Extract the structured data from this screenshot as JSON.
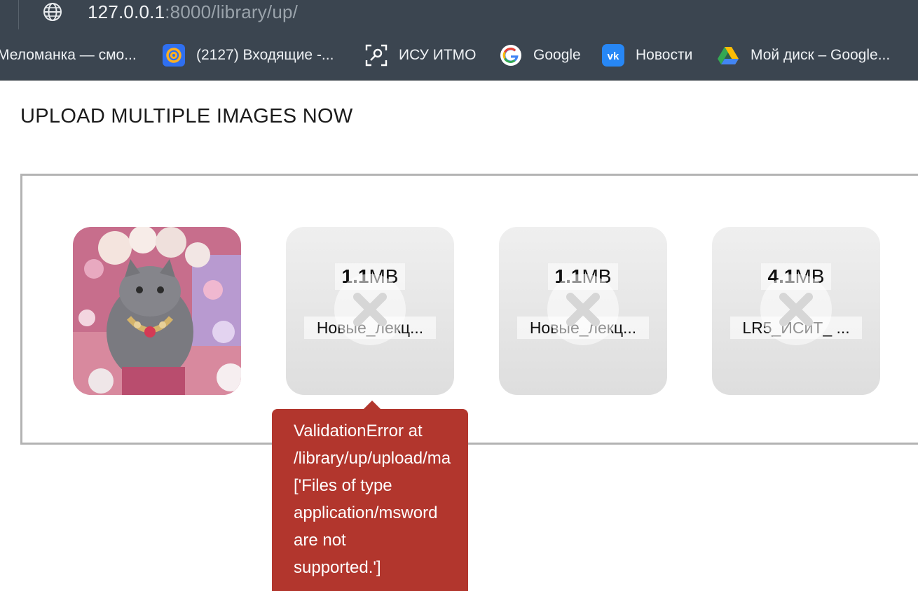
{
  "browser": {
    "url_host": "127.0.0.1",
    "url_rest": ":8000/library/up/",
    "bookmarks": [
      {
        "label": "Меломанка — смо...",
        "icon": "none"
      },
      {
        "label": "(2127) Входящие -...",
        "icon": "mail-icon"
      },
      {
        "label": "ИСУ ИТМО",
        "icon": "itmo-icon"
      },
      {
        "label": "Google",
        "icon": "google-icon"
      },
      {
        "label": "Новости",
        "icon": "vk-icon"
      },
      {
        "label": "Мой диск – Google...",
        "icon": "google-drive-icon"
      }
    ]
  },
  "page": {
    "title": "UPLOAD MULTIPLE IMAGES NOW"
  },
  "files": [
    {
      "size_num": "1.1",
      "size_unit": " MB",
      "name": "Новые_лекц...",
      "status": "error"
    },
    {
      "size_num": "1.1",
      "size_unit": " MB",
      "name": "Новые_лекц...",
      "status": "error"
    },
    {
      "size_num": "4.1",
      "size_unit": " MB",
      "name": "LR5_ИСиТ_ ...",
      "status": "error"
    }
  ],
  "error_tooltip": {
    "text": "ValidationError at\n/library/up/upload/ma\n['Files of type\napplication/msword\nare not\nsupported.']"
  },
  "colors": {
    "chrome_bg": "#3b4550",
    "error_bg": "#b2362d"
  }
}
